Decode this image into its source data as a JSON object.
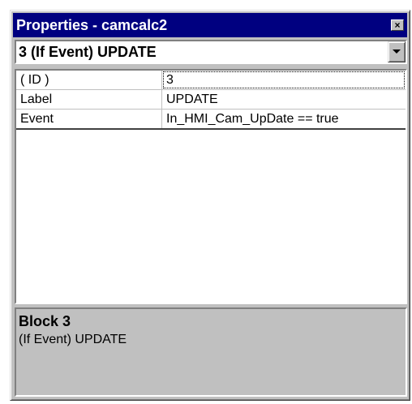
{
  "window": {
    "title": "Properties - camcalc2",
    "close_glyph": "×"
  },
  "selector": {
    "selected_value": "3 (If Event) UPDATE"
  },
  "properties": [
    {
      "name": "( ID )",
      "value": "3"
    },
    {
      "name": "Label",
      "value": "UPDATE"
    },
    {
      "name": "Event",
      "value": "In_HMI_Cam_UpDate == true"
    }
  ],
  "description": {
    "title": "Block 3",
    "text": "(If Event) UPDATE"
  },
  "icons": {
    "close": "close-icon",
    "dropdown": "chevron-down-icon"
  },
  "colors": {
    "titlebar": "#000080",
    "face": "#c0c0c0",
    "field": "#ffffff"
  }
}
